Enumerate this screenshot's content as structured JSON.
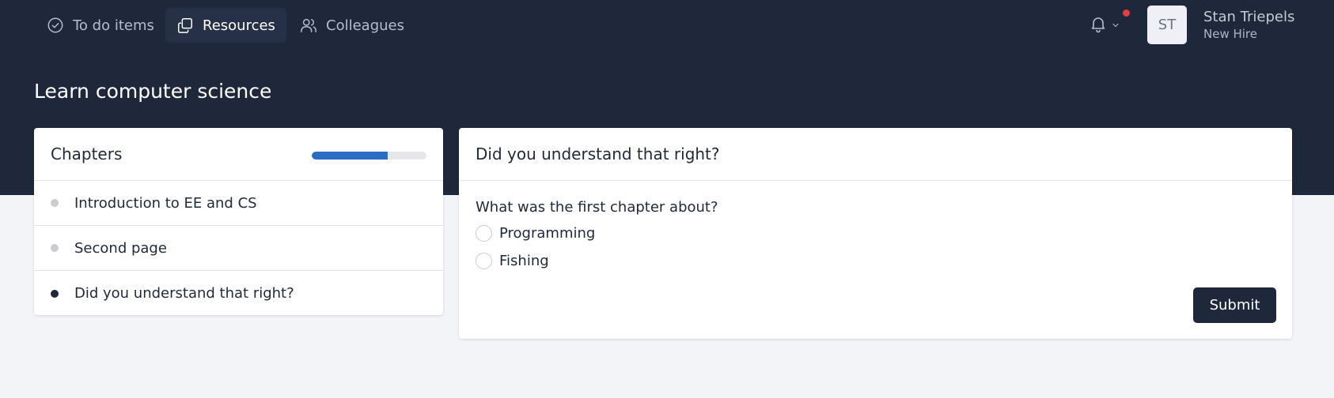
{
  "nav": {
    "items": [
      {
        "label": "To do items",
        "icon": "check-circle-icon",
        "active": false
      },
      {
        "label": "Resources",
        "icon": "copy-icon",
        "active": true
      },
      {
        "label": "Colleagues",
        "icon": "users-icon",
        "active": false
      }
    ],
    "notifications": {
      "icon": "bell-icon",
      "has_unread": true,
      "dot_color": "#e53e3e"
    }
  },
  "user": {
    "initials": "ST",
    "name": "Stan Triepels",
    "role": "New Hire"
  },
  "page": {
    "title": "Learn computer science"
  },
  "chapters": {
    "title": "Chapters",
    "progress_percent": 66,
    "items": [
      {
        "label": "Introduction to EE and CS",
        "current": false
      },
      {
        "label": "Second page",
        "current": false
      },
      {
        "label": "Did you understand that right?",
        "current": true
      }
    ]
  },
  "quiz": {
    "title": "Did you understand that right?",
    "question": "What was the first chapter about?",
    "options": [
      "Programming",
      "Fishing"
    ],
    "submit_label": "Submit"
  },
  "colors": {
    "header_bg": "#1f283b",
    "page_bg": "#f3f4f8",
    "accent": "#2b6cc4"
  }
}
